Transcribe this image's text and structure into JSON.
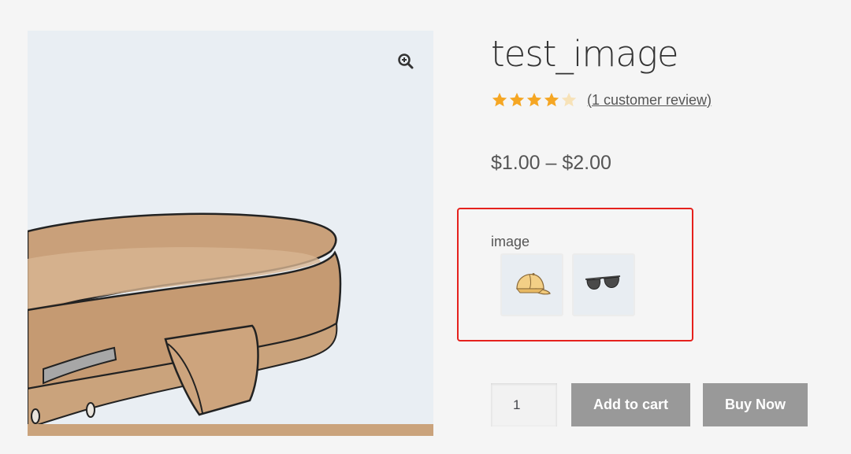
{
  "product": {
    "title": "test_image",
    "rating": 4,
    "rating_max": 5,
    "review_text": "(1 customer review)",
    "price": "$1.00 – $2.00"
  },
  "gallery": {
    "image_icon": "belt-image",
    "zoom_icon": "zoom-in-icon"
  },
  "variation": {
    "label": "image",
    "options": [
      {
        "name": "cap",
        "icon": "cap-icon"
      },
      {
        "name": "sunglasses",
        "icon": "sunglasses-icon"
      }
    ]
  },
  "cart": {
    "quantity": "1",
    "add_to_cart_label": "Add to cart",
    "buy_now_label": "Buy Now"
  },
  "colors": {
    "star": "#f5a623",
    "star_empty": "#f7e2b8",
    "button": "#999999",
    "highlight": "#e5211d"
  }
}
